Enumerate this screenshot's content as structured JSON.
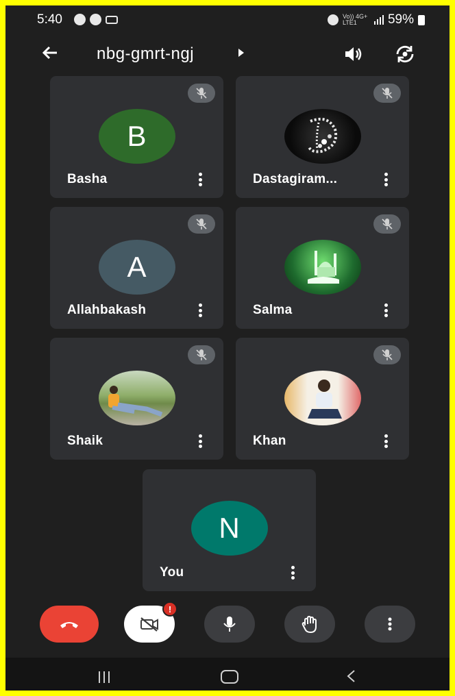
{
  "status_bar": {
    "time": "5:40",
    "network": "Vo)) 4G+ LTE1",
    "battery": "59%"
  },
  "app_bar": {
    "meeting_code": "nbg-gmrt-ngj"
  },
  "participants": [
    {
      "name": "Basha",
      "initial": "B",
      "avatar_color": "#2e6b2a",
      "muted": true
    },
    {
      "name": "Dastagiram...",
      "initial": "",
      "avatar_color": "#111111",
      "muted": true
    },
    {
      "name": "Allahbakash",
      "initial": "A",
      "avatar_color": "#455a64",
      "muted": true
    },
    {
      "name": "Salma",
      "initial": "",
      "avatar_color": "#1e6b2e",
      "muted": true
    },
    {
      "name": "Shaik",
      "initial": "",
      "avatar_color": "#7a8a5a",
      "muted": true
    },
    {
      "name": "Khan",
      "initial": "",
      "avatar_color": "#d9c9a8",
      "muted": true
    },
    {
      "name": "You",
      "initial": "N",
      "avatar_color": "#00796b",
      "muted": false
    }
  ],
  "controls": {
    "camera_badge": "!",
    "end_call_color": "#ea4335"
  },
  "colors": {
    "background": "#1f1f1f",
    "tile": "#2f3033",
    "border": "#ffff00"
  }
}
